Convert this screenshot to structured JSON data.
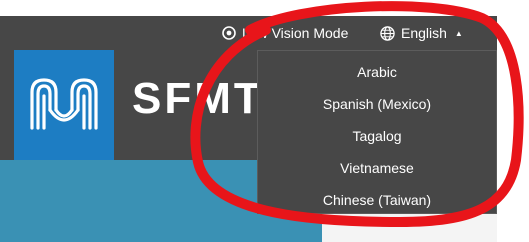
{
  "topbar": {
    "low_vision_label": "Low Vision Mode",
    "low_vision_icon": "eye-icon",
    "language_label": "English",
    "language_icon": "globe-icon",
    "caret_icon": "caret-up-icon"
  },
  "header": {
    "brand_text": "SFMTA",
    "logo_icon": "sfmta-logo",
    "logo_color": "#1d7dc3"
  },
  "language_menu": {
    "items": [
      {
        "label": "Arabic"
      },
      {
        "label": "Spanish (Mexico)"
      },
      {
        "label": "Tagalog"
      },
      {
        "label": "Vietnamese"
      },
      {
        "label": "Chinese (Taiwan)"
      }
    ]
  },
  "colors": {
    "bar": "#474747",
    "accent_teal": "#3a91b4",
    "annotation": "#e8151a"
  }
}
